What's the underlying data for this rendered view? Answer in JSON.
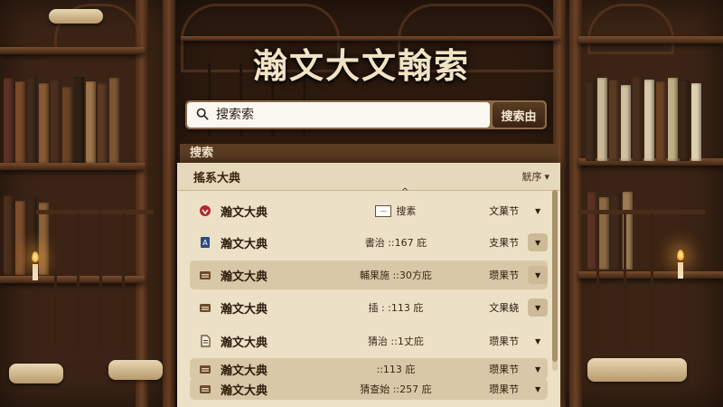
{
  "app": {
    "title": "瀚文大文翰索"
  },
  "search": {
    "placeholder": "搜索索",
    "value": "",
    "button_label": "搜索由"
  },
  "results": {
    "header": "搜索",
    "subheader": "搖系大典",
    "sort_label": "觥序",
    "sort_icon": "caret-down-icon",
    "rows": [
      {
        "icon": "heart-shield-icon",
        "icon_color": "#b3262b",
        "name": "瀚文大典",
        "detail": "搜素",
        "has_flag": true,
        "tag": "文菓节",
        "shaded": false
      },
      {
        "icon": "blue-bookmark-icon",
        "icon_color": "#2b4a8a",
        "name": "瀚文大典",
        "detail": "書治 ::167 庇",
        "has_flag": false,
        "tag": "支果节",
        "shaded": false
      },
      {
        "icon": "folder-icon",
        "icon_color": "#6b4b2a",
        "name": "瀚文大典",
        "detail": "輔果施 ::30方庇",
        "has_flag": false,
        "tag": "瓒果节",
        "shaded": true
      },
      {
        "icon": "folder-icon",
        "icon_color": "#6b4b2a",
        "name": "瀚文大典",
        "detail": "插 : :113 庇",
        "has_flag": false,
        "tag": "文果蛲",
        "shaded": false
      },
      {
        "icon": "document-icon",
        "icon_color": "#5a4028",
        "name": "瀚文大典",
        "detail": "猜治 ::1丈庇",
        "has_flag": false,
        "tag": "瓒果节",
        "shaded": false
      },
      {
        "icon": "folder-icon",
        "icon_color": "#6b4b2a",
        "name": "瀚文大典",
        "detail": "::113 庇",
        "has_flag": false,
        "tag": "瓒果节",
        "shaded": true
      },
      {
        "icon": "folder-icon",
        "icon_color": "#6b4b2a",
        "name": "瀚文大典",
        "detail": "猜查始 ::257 庇",
        "has_flag": false,
        "tag": "瓒果节",
        "shaded": true
      }
    ]
  }
}
